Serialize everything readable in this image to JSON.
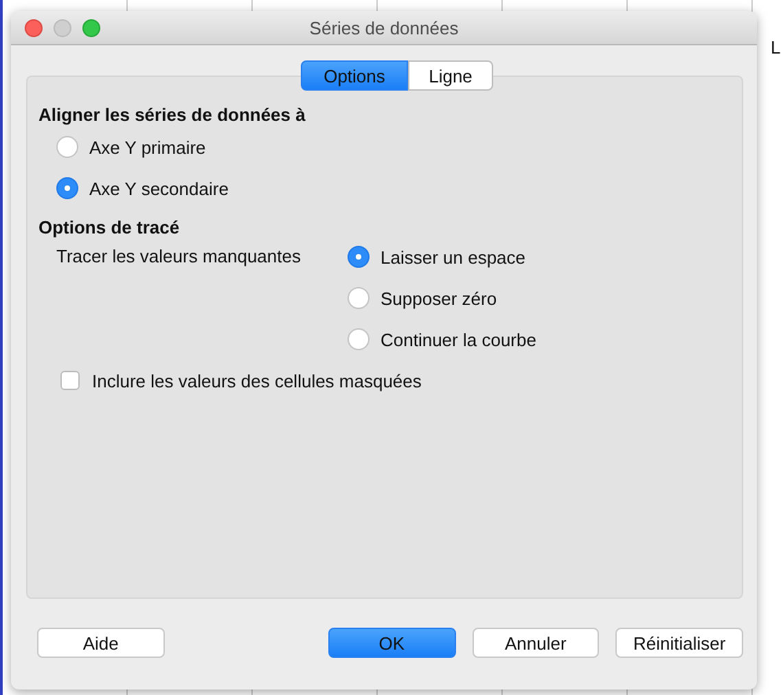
{
  "background": {
    "column_label": "L"
  },
  "window": {
    "title": "Séries de données"
  },
  "tabs": [
    {
      "label": "Options",
      "selected": true
    },
    {
      "label": "Ligne",
      "selected": false
    }
  ],
  "align_section": {
    "heading": "Aligner les séries de données à",
    "options": [
      {
        "label": "Axe Y primaire",
        "selected": false
      },
      {
        "label": "Axe Y secondaire",
        "selected": true
      }
    ]
  },
  "plot_section": {
    "heading": "Options de tracé",
    "missing_values_label": "Tracer les valeurs manquantes",
    "options": [
      {
        "label": "Laisser un espace",
        "selected": true
      },
      {
        "label": "Supposer zéro",
        "selected": false
      },
      {
        "label": "Continuer la courbe",
        "selected": false
      }
    ],
    "hidden_cells": {
      "label": "Inclure les valeurs des cellules masquées",
      "checked": false
    }
  },
  "buttons": [
    {
      "label": "Aide",
      "kind": "help"
    },
    {
      "label": "OK",
      "kind": "default"
    },
    {
      "label": "Annuler",
      "kind": "normal"
    },
    {
      "label": "Réinitialiser",
      "kind": "normal"
    }
  ]
}
